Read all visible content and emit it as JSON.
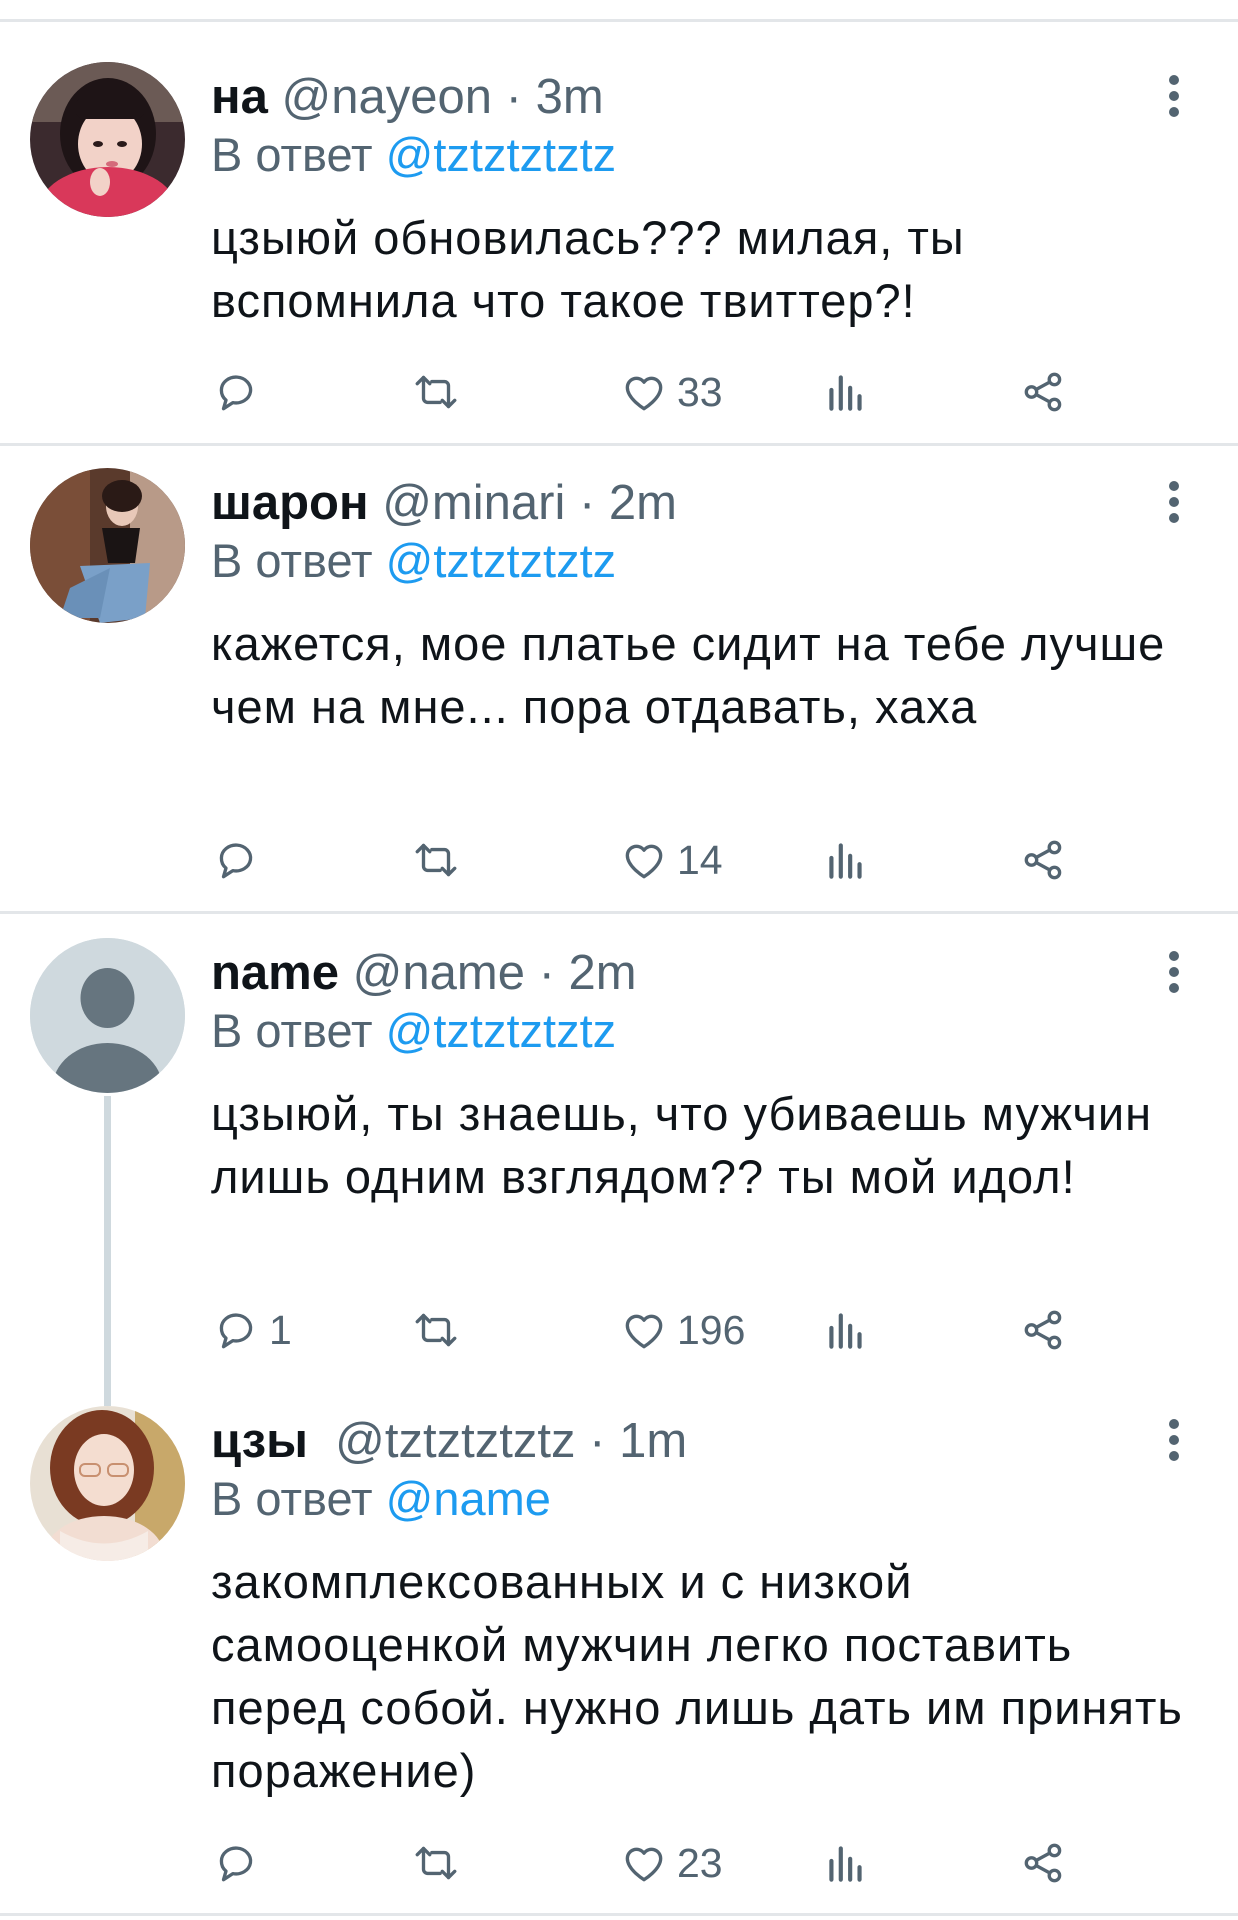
{
  "reply_prefix": "В ответ",
  "tweets": [
    {
      "display_name": "на",
      "handle": "@nayeon",
      "time": "3m",
      "reply_to": "@tztztztztz",
      "text": "цзыюй обновилась??? милая, ты вспомнила что такое твиттер?!",
      "replies": "",
      "likes": "33",
      "avatar": "photo-girl-red-sweater"
    },
    {
      "display_name": "шарон",
      "handle": "@minari",
      "time": "2m",
      "reply_to": "@tztztztztz",
      "text": "кажется, мое платье сидит на тебе лучше чем на мне... пора отдавать, хаха",
      "replies": "",
      "likes": "14",
      "avatar": "photo-girl-jeans"
    },
    {
      "display_name": "name",
      "handle": "@name",
      "time": "2m",
      "reply_to": "@tztztztztz",
      "text": "цзыюй, ты знаешь, что убиваешь мужчин лишь одним взглядом?? ты мой идол!",
      "replies": "1",
      "likes": "196",
      "avatar": "default-person-icon"
    },
    {
      "display_name": "цзы",
      "handle": "@tztztztztz",
      "time": "1m",
      "reply_to": "@name",
      "text": "закомплексованных и с низкой самооценкой мужчин легко поставить перед собой. нужно лишь дать им принять поражение)",
      "replies": "",
      "likes": "23",
      "avatar": "photo-girl-glasses"
    }
  ],
  "colors": {
    "link": "#1d9bf0",
    "secondary_text": "#536471",
    "divider": "#e3e6e9",
    "thread_line": "#cfd9de"
  }
}
